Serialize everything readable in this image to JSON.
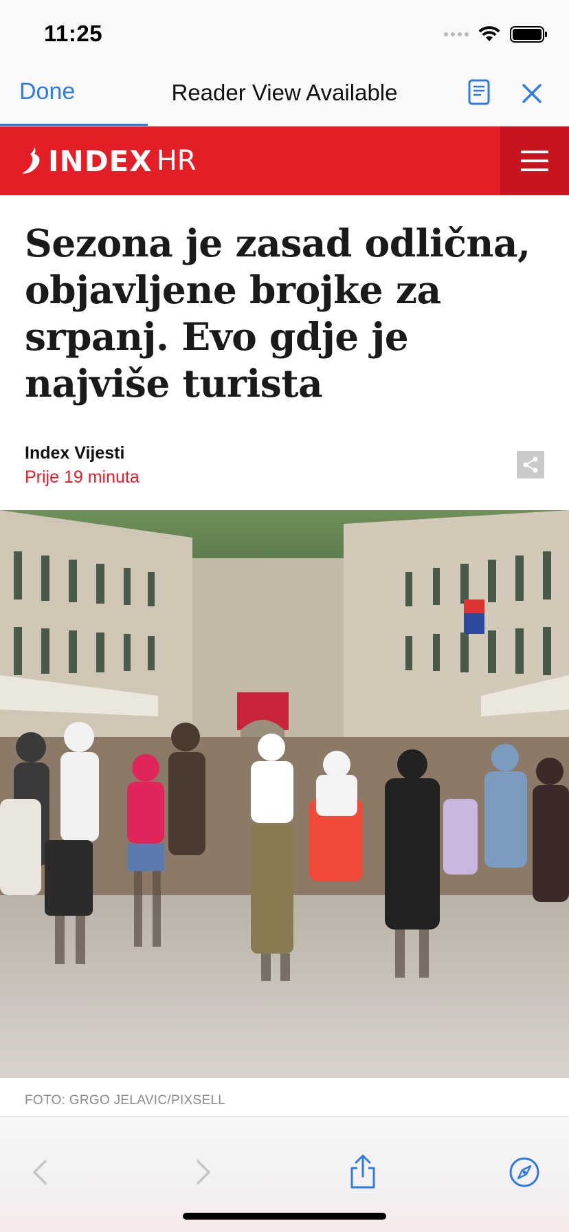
{
  "status_bar": {
    "time": "11:25"
  },
  "browser": {
    "done_label": "Done",
    "title": "Reader View Available",
    "load_progress": 0.26,
    "accent_color": "#2d7be3"
  },
  "site": {
    "logo_main": "INDEX",
    "logo_suffix": "HR",
    "brand_color": "#e41e26"
  },
  "article": {
    "title": "Sezona je zasad odlična, objavljene brojke za srpanj. Evo gdje je najviše turista",
    "author": "Index Vijesti",
    "published": "Prije 19 minuta",
    "photo_credit": "FOTO: GRGO JELAVIC/PIXSELL"
  },
  "icons": {
    "reader": "reader-view-icon",
    "close": "close-icon",
    "menu": "hamburger-menu-icon",
    "share": "share-icon",
    "back": "chevron-left-icon",
    "forward": "chevron-right-icon",
    "action": "share-up-icon",
    "safari": "compass-icon"
  }
}
